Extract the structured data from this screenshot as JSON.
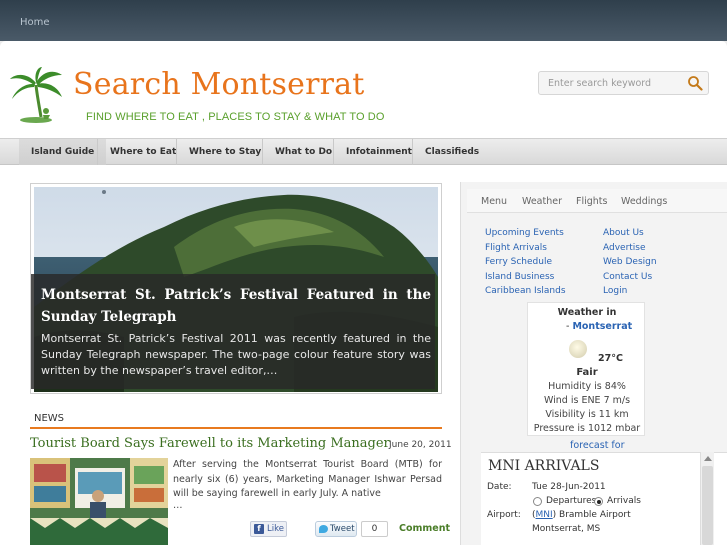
{
  "topbar": {
    "home_label": "Home"
  },
  "header": {
    "site_title": "Search Montserrat",
    "tagline": "FIND WHERE TO EAT , PLACES TO STAY & WHAT TO DO",
    "search_placeholder": "Enter search keyword"
  },
  "nav": {
    "items": [
      {
        "label": "Island Guide"
      },
      {
        "label": "Where to Eat"
      },
      {
        "label": "Where to Stay"
      },
      {
        "label": "What to Do"
      },
      {
        "label": "Infotainment"
      },
      {
        "label": "Classifieds"
      }
    ]
  },
  "feature": {
    "title": "Montserrat St. Patrick’s Festival Featured in the Sunday Telegraph",
    "text": "Montserrat St. Patrick’s Festival 2011 was recently featured in the Sunday Telegraph newspaper. The two-page colour feature story was written by the newspaper’s travel editor,…"
  },
  "news": {
    "section_label": "NEWS",
    "title": "Tourist Board Says Farewell to its Marketing Manager",
    "date": "June 20, 2011",
    "excerpt": "After serving the Montserrat Tourist Board (MTB) for nearly six (6) years, Marketing Manager Ishwar Persad will be saying farewell in early July. A native",
    "more": "…",
    "like_label": "Like",
    "tweet_label": "Tweet",
    "tweet_count": "0",
    "comment_label": "Comment"
  },
  "sidebar": {
    "tabs": [
      {
        "label": "Menu"
      },
      {
        "label": "Weather"
      },
      {
        "label": "Flights"
      },
      {
        "label": "Weddings"
      }
    ],
    "links_left": [
      "Upcoming Events",
      "Flight Arrivals",
      "Ferry Schedule",
      "Island Business",
      "Caribbean Islands"
    ],
    "links_right": [
      "About Us",
      "Advertise",
      "Web Design",
      "Contact Us",
      "Login"
    ],
    "weather": {
      "title": "Weather in",
      "location_prefix": "- ",
      "location": "Montserrat",
      "temp": "27°C",
      "condition": "Fair",
      "humidity": "Humidity is 84%",
      "wind": "Wind is ENE 7 m/s",
      "visibility": "Visibility is 11 km",
      "pressure": "Pressure is 1012 mbar",
      "forecast_link": "forecast for"
    },
    "arrivals": {
      "title": "MNI ARRIVALS",
      "date_label": "Date:",
      "date_value": "Tue 28-Jun-2011",
      "option_departures": "Departures",
      "option_arrivals": "Arrivals",
      "airport_label": "Airport:",
      "airport_code": "MNI",
      "airport_name": "Bramble Airport",
      "airport_location": "Montserrat, MS"
    }
  }
}
